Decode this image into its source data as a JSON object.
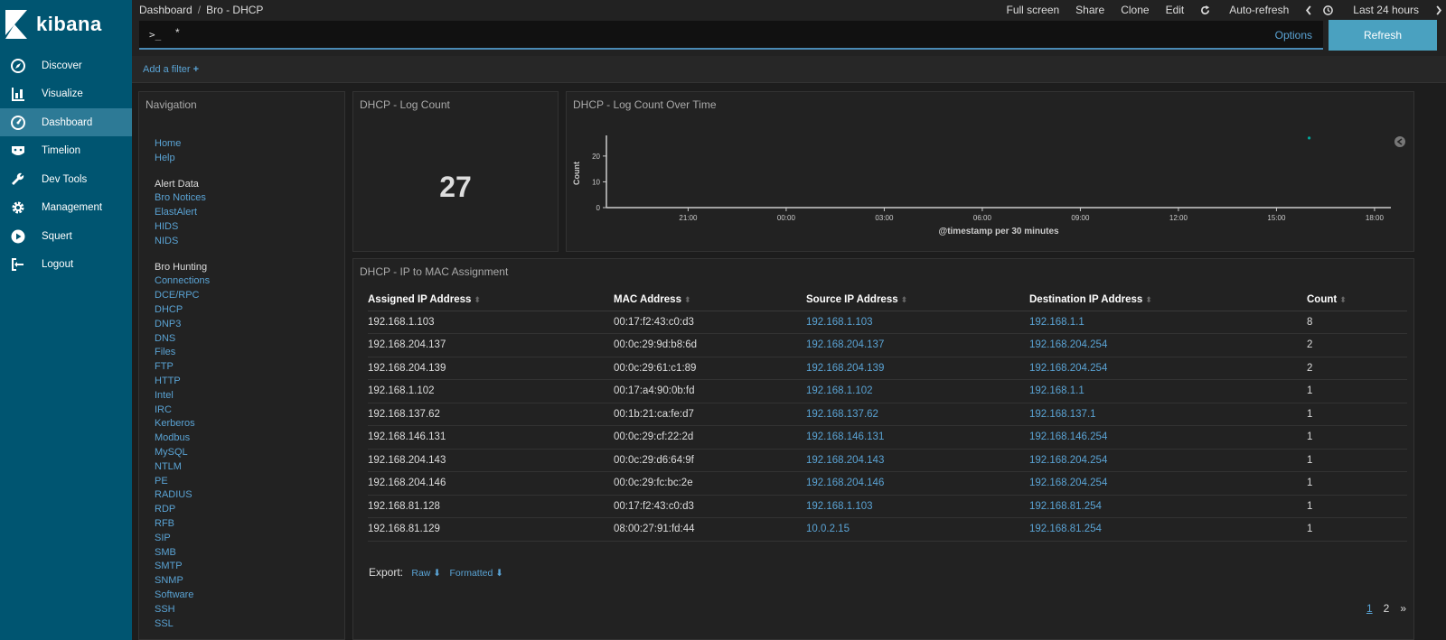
{
  "app": {
    "name": "kibana"
  },
  "sidebar": {
    "items": [
      {
        "label": "Discover",
        "icon": "compass-icon"
      },
      {
        "label": "Visualize",
        "icon": "bar-chart-icon"
      },
      {
        "label": "Dashboard",
        "icon": "dashboard-icon",
        "active": true
      },
      {
        "label": "Timelion",
        "icon": "timelion-icon"
      },
      {
        "label": "Dev Tools",
        "icon": "wrench-icon"
      },
      {
        "label": "Management",
        "icon": "gear-icon"
      },
      {
        "label": "Squert",
        "icon": "play-icon"
      },
      {
        "label": "Logout",
        "icon": "logout-icon"
      }
    ]
  },
  "header": {
    "breadcrumb_root": "Dashboard",
    "breadcrumb_sep": "/",
    "breadcrumb_current": "Bro - DHCP",
    "actions": {
      "full_screen": "Full screen",
      "share": "Share",
      "clone": "Clone",
      "edit": "Edit",
      "auto_refresh": "Auto-refresh",
      "time_range": "Last 24 hours"
    }
  },
  "query": {
    "prompt": ">_",
    "value": "*",
    "options_label": "Options",
    "refresh_label": "Refresh"
  },
  "filters": {
    "add_label": "Add a filter"
  },
  "nav_panel": {
    "title": "Navigation",
    "groups": [
      {
        "head": null,
        "links": [
          "Home",
          "Help"
        ]
      },
      {
        "head": "Alert Data",
        "links": [
          "Bro Notices",
          "ElastAlert",
          "HIDS",
          "NIDS"
        ]
      },
      {
        "head": "Bro Hunting",
        "links": [
          "Connections",
          "DCE/RPC",
          "DHCP",
          "DNP3",
          "DNS",
          "Files",
          "FTP",
          "HTTP",
          "Intel",
          "IRC",
          "Kerberos",
          "Modbus",
          "MySQL",
          "NTLM",
          "PE",
          "RADIUS",
          "RDP",
          "RFB",
          "SIP",
          "SMB",
          "SMTP",
          "SNMP",
          "Software",
          "SSH",
          "SSL"
        ]
      }
    ]
  },
  "count_panel": {
    "title": "DHCP - Log Count",
    "value": "27"
  },
  "time_panel": {
    "title": "DHCP - Log Count Over Time"
  },
  "chart_data": {
    "type": "scatter",
    "ylabel": "Count",
    "xlabel": "@timestamp per 30 minutes",
    "y_ticks": [
      "0",
      "10",
      "20"
    ],
    "ylim": [
      0,
      28
    ],
    "x_ticks": [
      "21:00",
      "00:00",
      "03:00",
      "06:00",
      "09:00",
      "12:00",
      "15:00",
      "18:00"
    ],
    "x_range_hours": [
      18.5,
      42.5
    ],
    "x_tick_hours": [
      21,
      24,
      27,
      30,
      33,
      36,
      39,
      42
    ],
    "points": [
      {
        "x_hours": 40.0,
        "y": 27
      }
    ],
    "color": "#00a69b"
  },
  "table_panel": {
    "title": "DHCP - IP to MAC Assignment",
    "columns": [
      "Assigned IP Address",
      "MAC Address",
      "Source IP Address",
      "Destination IP Address",
      "Count"
    ],
    "rows": [
      [
        "192.168.1.103",
        "00:17:f2:43:c0:d3",
        "192.168.1.103",
        "192.168.1.1",
        "8"
      ],
      [
        "192.168.204.137",
        "00:0c:29:9d:b8:6d",
        "192.168.204.137",
        "192.168.204.254",
        "2"
      ],
      [
        "192.168.204.139",
        "00:0c:29:61:c1:89",
        "192.168.204.139",
        "192.168.204.254",
        "2"
      ],
      [
        "192.168.1.102",
        "00:17:a4:90:0b:fd",
        "192.168.1.102",
        "192.168.1.1",
        "1"
      ],
      [
        "192.168.137.62",
        "00:1b:21:ca:fe:d7",
        "192.168.137.62",
        "192.168.137.1",
        "1"
      ],
      [
        "192.168.146.131",
        "00:0c:29:cf:22:2d",
        "192.168.146.131",
        "192.168.146.254",
        "1"
      ],
      [
        "192.168.204.143",
        "00:0c:29:d6:64:9f",
        "192.168.204.143",
        "192.168.204.254",
        "1"
      ],
      [
        "192.168.204.146",
        "00:0c:29:fc:bc:2e",
        "192.168.204.146",
        "192.168.204.254",
        "1"
      ],
      [
        "192.168.81.128",
        "00:17:f2:43:c0:d3",
        "192.168.1.103",
        "192.168.81.254",
        "1"
      ],
      [
        "192.168.81.129",
        "08:00:27:91:fd:44",
        "10.0.2.15",
        "192.168.81.254",
        "1"
      ]
    ],
    "export_label": "Export:",
    "export_raw": "Raw",
    "export_formatted": "Formatted",
    "pages": [
      "1",
      "2"
    ],
    "next_label": "»"
  }
}
